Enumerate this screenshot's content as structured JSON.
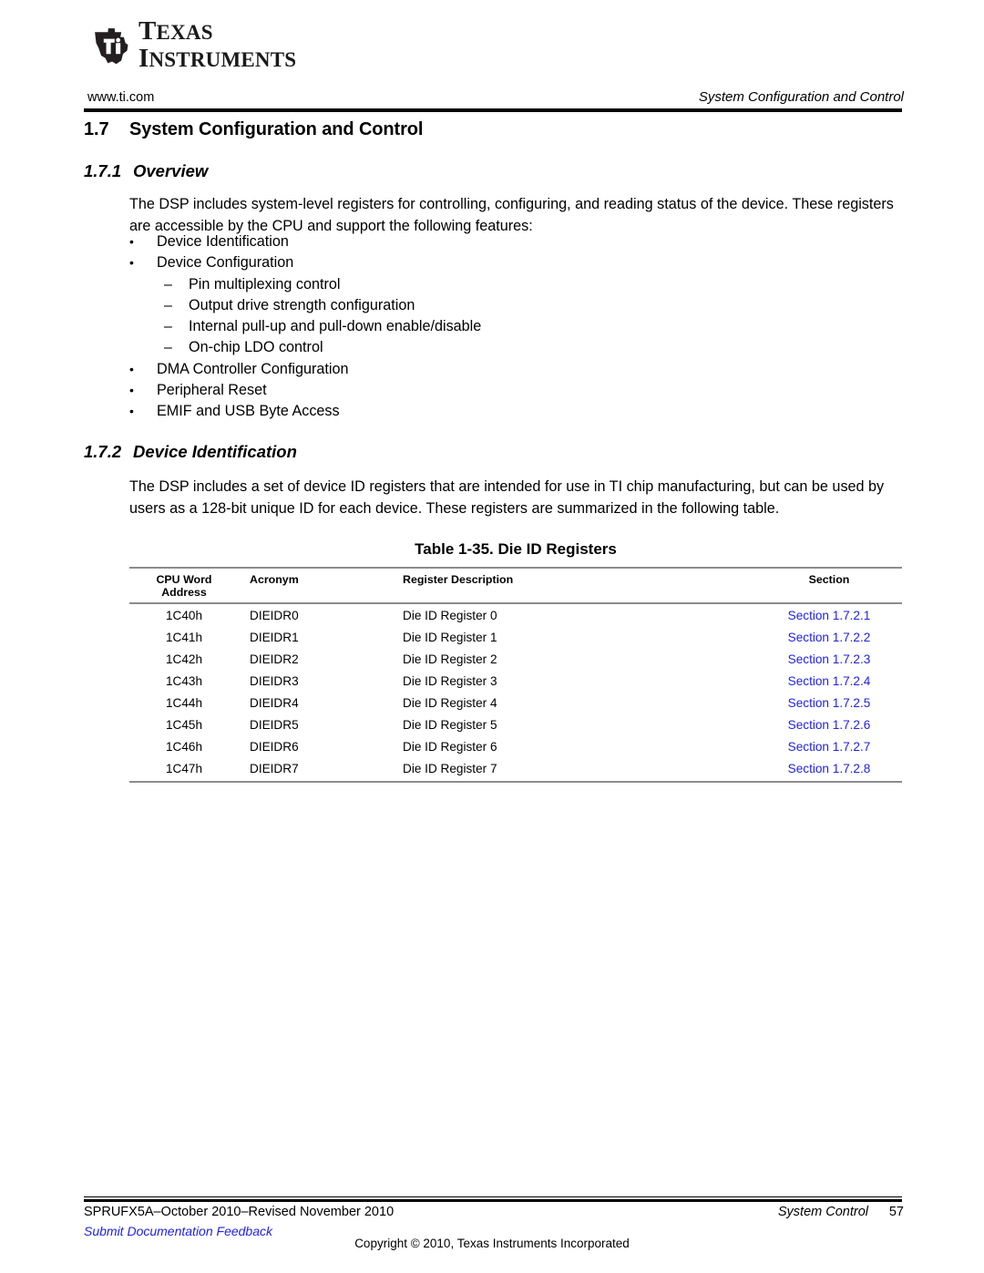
{
  "logo": {
    "mark": "ti-texas-logo-icon",
    "line1_cap": "T",
    "line1_rest": "EXAS",
    "line2_cap": "I",
    "line2_rest": "NSTRUMENTS"
  },
  "header": {
    "url": "www.ti.com",
    "running_title": "System Configuration and Control"
  },
  "sections": {
    "s17": {
      "number": "1.7",
      "title": "System Configuration and Control"
    },
    "s171": {
      "number": "1.7.1",
      "title": "Overview",
      "paragraph": "The DSP includes system-level registers for controlling, configuring, and reading status of the device. These registers are accessible by the CPU and support the following features:"
    },
    "s172": {
      "number": "1.7.2",
      "title": "Device Identification",
      "paragraph": "The DSP includes a set of device ID registers that are intended for use in TI chip manufacturing, but can be used by users as a 128-bit unique ID for each device. These registers are summarized in the following table."
    }
  },
  "feature_list": [
    {
      "level": 1,
      "marker": "•",
      "text": "Device Identification"
    },
    {
      "level": 1,
      "marker": "•",
      "text": "Device Configuration"
    },
    {
      "level": 2,
      "marker": "–",
      "text": "Pin multiplexing control"
    },
    {
      "level": 2,
      "marker": "–",
      "text": "Output drive strength configuration"
    },
    {
      "level": 2,
      "marker": "–",
      "text": "Internal pull-up and pull-down enable/disable"
    },
    {
      "level": 2,
      "marker": "–",
      "text": "On-chip LDO control"
    },
    {
      "level": 1,
      "marker": "•",
      "text": "DMA Controller Configuration"
    },
    {
      "level": 1,
      "marker": "•",
      "text": "Peripheral Reset"
    },
    {
      "level": 1,
      "marker": "•",
      "text": "EMIF and USB Byte Access"
    }
  ],
  "table": {
    "caption": "Table 1-35. Die ID Registers",
    "columns": [
      {
        "label": "CPU Word",
        "sublabel": "Address"
      },
      {
        "label": "Acronym",
        "sublabel": ""
      },
      {
        "label": "Register Description",
        "sublabel": ""
      },
      {
        "label": "Section",
        "sublabel": ""
      }
    ],
    "rows": [
      {
        "address": "1C40h",
        "acronym": "DIEIDR0",
        "description": "Die ID Register 0",
        "section": "Section 1.7.2.1"
      },
      {
        "address": "1C41h",
        "acronym": "DIEIDR1",
        "description": "Die ID Register 1",
        "section": "Section 1.7.2.2"
      },
      {
        "address": "1C42h",
        "acronym": "DIEIDR2",
        "description": "Die ID Register 2",
        "section": "Section 1.7.2.3"
      },
      {
        "address": "1C43h",
        "acronym": "DIEIDR3",
        "description": "Die ID Register 3",
        "section": "Section 1.7.2.4"
      },
      {
        "address": "1C44h",
        "acronym": "DIEIDR4",
        "description": "Die ID Register 4",
        "section": "Section 1.7.2.5"
      },
      {
        "address": "1C45h",
        "acronym": "DIEIDR5",
        "description": "Die ID Register 5",
        "section": "Section 1.7.2.6"
      },
      {
        "address": "1C46h",
        "acronym": "DIEIDR6",
        "description": "Die ID Register 6",
        "section": "Section 1.7.2.7"
      },
      {
        "address": "1C47h",
        "acronym": "DIEIDR7",
        "description": "Die ID Register 7",
        "section": "Section 1.7.2.8"
      }
    ]
  },
  "footer": {
    "document_id": "SPRUFX5A–October 2010–Revised November 2010",
    "feedback_link": "Submit Documentation Feedback",
    "chapter": "System Control",
    "page_number": "57",
    "copyright": "Copyright © 2010, Texas Instruments Incorporated"
  },
  "colors": {
    "link": "#2222e0",
    "rule": "#000000",
    "table_rule": "#8c8c8c"
  }
}
